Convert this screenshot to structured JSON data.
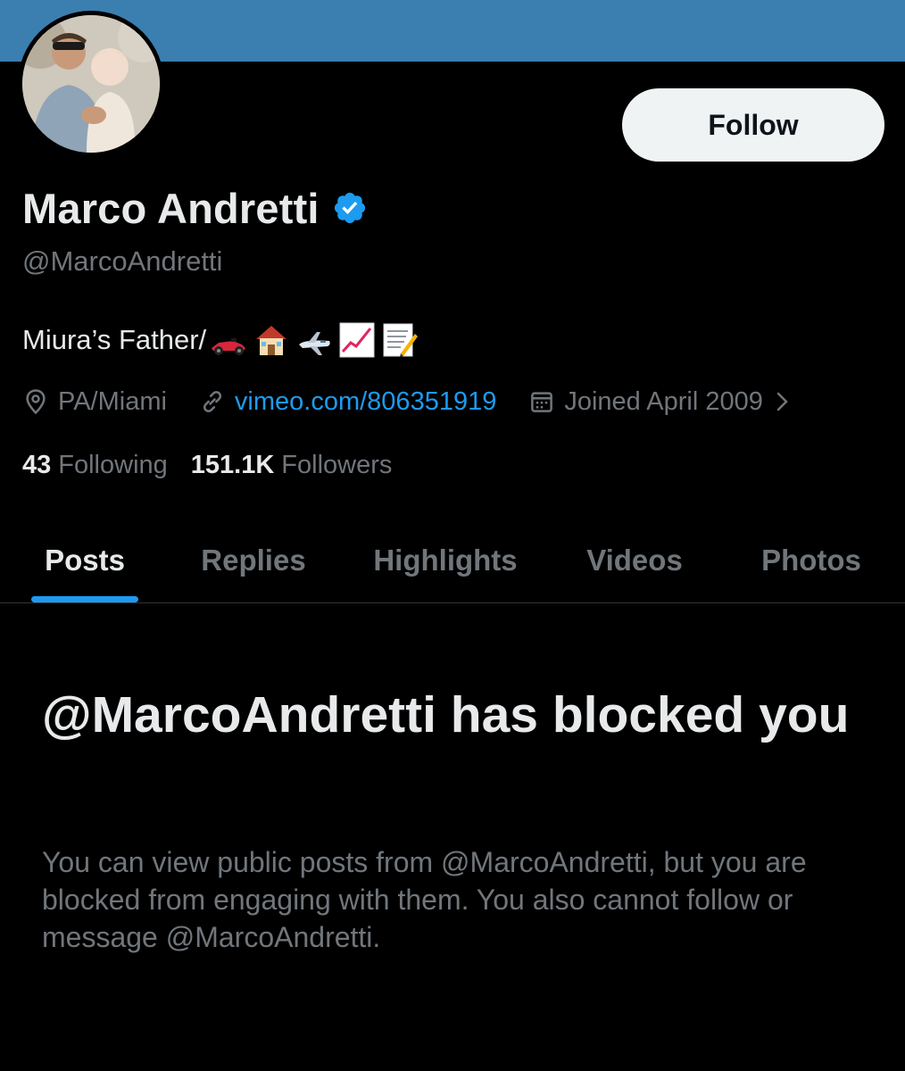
{
  "profile": {
    "display_name": "Marco Andretti",
    "handle": "@MarcoAndretti",
    "bio_text": "Miura’s Father/",
    "bio_emoji": [
      "race-car",
      "house",
      "airplane",
      "chart-increasing",
      "memo"
    ],
    "location": "PA/Miami",
    "website": "vimeo.com/806351919",
    "joined": "Joined April 2009",
    "following_count": "43",
    "following_label": "Following",
    "followers_count": "151.1K",
    "followers_label": "Followers",
    "verified": true
  },
  "actions": {
    "follow_label": "Follow"
  },
  "tabs": [
    {
      "label": "Posts",
      "active": true
    },
    {
      "label": "Replies",
      "active": false
    },
    {
      "label": "Highlights",
      "active": false
    },
    {
      "label": "Videos",
      "active": false
    },
    {
      "label": "Photos",
      "active": false
    }
  ],
  "blocked": {
    "title": "@MarcoAndretti has blocked you",
    "message": "You can view public posts from @MarcoAndretti, but you are blocked from engaging with them. You also cannot follow or message @MarcoAndretti."
  },
  "colors": {
    "banner": "#3a7fb0",
    "background": "#000000",
    "accent": "#1d9bf0",
    "text_primary": "#e7e9ea",
    "text_secondary": "#71767b"
  }
}
